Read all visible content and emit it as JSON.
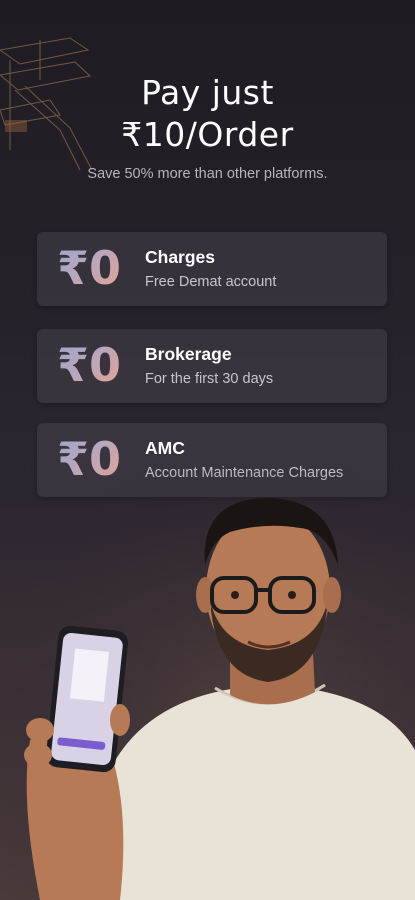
{
  "headline": {
    "line1": "Pay just",
    "line2": "₹10/Order"
  },
  "subtitle": "Save 50% more than other platforms.",
  "cards": [
    {
      "value": "₹0",
      "title": "Charges",
      "desc": "Free Demat account"
    },
    {
      "value": "₹0",
      "title": "Brokerage",
      "desc": "For the first 30 days"
    },
    {
      "value": "₹0",
      "title": "AMC",
      "desc": "Account Maintenance Charges"
    }
  ],
  "colors": {
    "accent_gradient": [
      "#9aa8c8",
      "#e7a48d"
    ],
    "background": "#1e1b22"
  }
}
